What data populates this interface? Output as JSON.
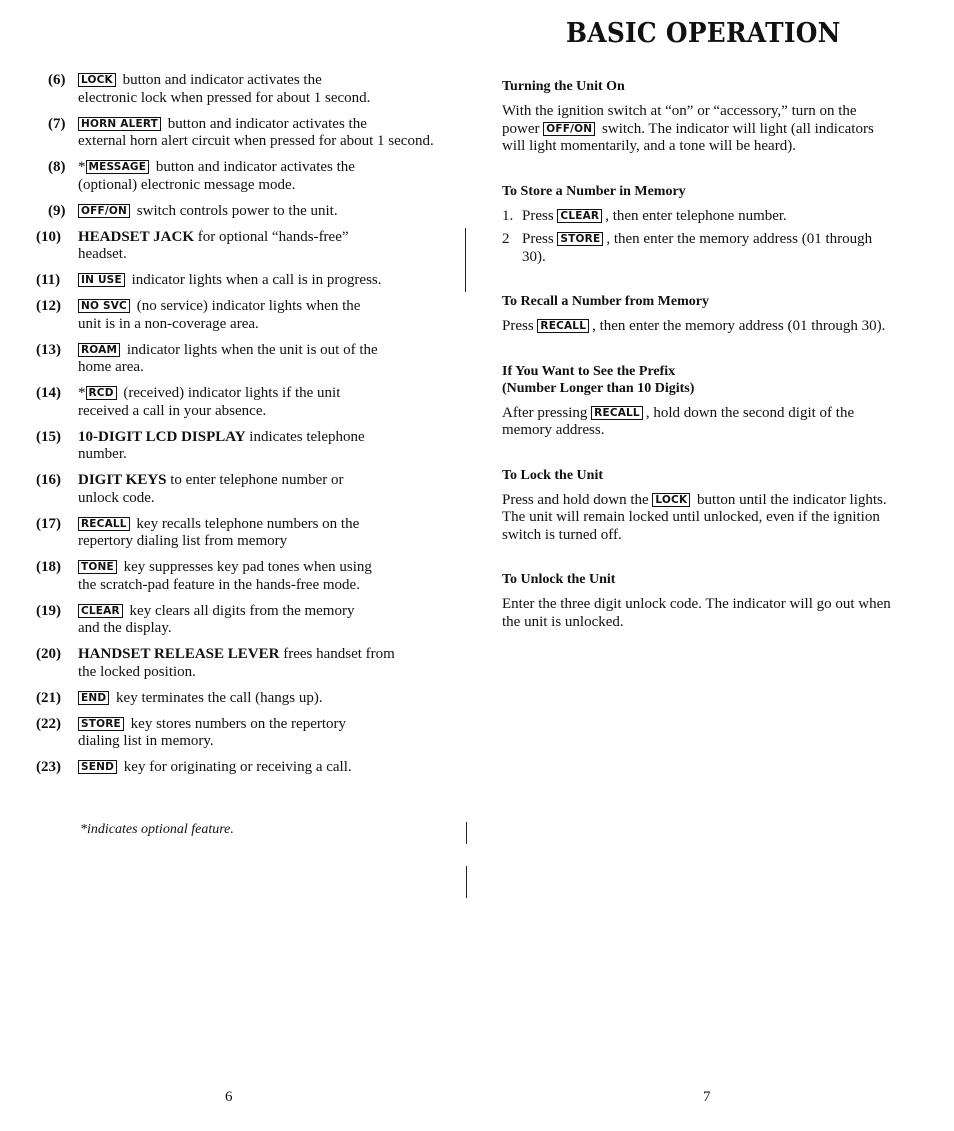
{
  "header": {
    "title": "BASIC OPERATION"
  },
  "left_column": {
    "items": [
      {
        "num": "(6)",
        "prefix": "",
        "key": "LOCK",
        "term": "",
        "text": "button and indicator activates the",
        "cont": "electronic lock when pressed for about 1 second."
      },
      {
        "num": "(7)",
        "prefix": "",
        "key": "HORN ALERT",
        "term": "",
        "text": "button and indicator activates the",
        "cont": "external horn alert circuit when pressed for about 1 second."
      },
      {
        "num": "(8)",
        "prefix": "*",
        "key": "MESSAGE",
        "term": "",
        "text": "button and indicator activates the",
        "cont": "(optional) electronic message mode."
      },
      {
        "num": "(9)",
        "prefix": "",
        "key": "OFF/ON",
        "term": "",
        "text": "switch controls power to the unit.",
        "cont": ""
      },
      {
        "num": "(10)",
        "prefix": "",
        "key": "",
        "term": "HEADSET JACK",
        "text": "for optional “hands-free”",
        "cont": "headset."
      },
      {
        "num": "(11)",
        "prefix": "",
        "key": "IN USE",
        "term": "",
        "text": "indicator lights when a call is in progress.",
        "cont": ""
      },
      {
        "num": "(12)",
        "prefix": "",
        "key": "NO SVC",
        "term": "",
        "text": "(no service) indicator lights when the",
        "cont": "unit is in a non-coverage area."
      },
      {
        "num": "(13)",
        "prefix": "",
        "key": "ROAM",
        "term": "",
        "text": "indicator lights when the unit is out of the",
        "cont": "home area."
      },
      {
        "num": "(14)",
        "prefix": "*",
        "key": "RCD",
        "term": "",
        "text": "(received) indicator lights if the unit",
        "cont": "received a call in your absence."
      },
      {
        "num": "(15)",
        "prefix": "",
        "key": "",
        "term": "10-DIGIT LCD DISPLAY",
        "text": "indicates telephone",
        "cont": "number."
      },
      {
        "num": "(16)",
        "prefix": "",
        "key": "",
        "term": "DIGIT KEYS",
        "text": "to enter telephone number or",
        "cont": "unlock code."
      },
      {
        "num": "(17)",
        "prefix": "",
        "key": "RECALL",
        "term": "",
        "text": "key recalls telephone numbers on the",
        "cont": "repertory dialing list from memory"
      },
      {
        "num": "(18)",
        "prefix": "",
        "key": "TONE",
        "term": "",
        "text": "key suppresses key pad tones when using",
        "cont": "the scratch-pad feature in the hands-free mode."
      },
      {
        "num": "(19)",
        "prefix": "",
        "key": "CLEAR",
        "term": "",
        "text": "key clears all digits from the memory",
        "cont": "and the display."
      },
      {
        "num": "(20)",
        "prefix": "",
        "key": "",
        "term": "HANDSET RELEASE LEVER",
        "text": "frees handset from",
        "cont": "the locked position."
      },
      {
        "num": "(21)",
        "prefix": "",
        "key": "END",
        "term": "",
        "text": "key terminates the call (hangs up).",
        "cont": ""
      },
      {
        "num": "(22)",
        "prefix": "",
        "key": "STORE",
        "term": "",
        "text": "key stores numbers on the repertory",
        "cont": "dialing list in memory."
      },
      {
        "num": "(23)",
        "prefix": "",
        "key": "SEND",
        "term": "",
        "text": "key for originating or receiving a call.",
        "cont": ""
      }
    ],
    "footnote": "*indicates optional feature."
  },
  "right_column": {
    "turn_on": {
      "heading": "Turning the Unit On",
      "before": "With the ignition switch at “on” or “accessory,” turn on the power",
      "key": "OFF/ON",
      "after": "switch. The indicator will light (all indicators will light momentarily, and a tone will be heard)."
    },
    "store": {
      "heading": "To Store a Number in Memory",
      "steps": [
        {
          "num": "1.",
          "before": "Press",
          "key": "CLEAR",
          "after": ", then enter telephone number."
        },
        {
          "num": "2",
          "before": "Press",
          "key": "STORE",
          "after": ", then enter the memory address (01 through 30)."
        }
      ]
    },
    "recall": {
      "heading": "To Recall a Number from Memory",
      "before": "Press",
      "key": "RECALL",
      "after": ", then enter the memory address (01 through 30)."
    },
    "prefix": {
      "heading_line1": "If You Want to See the Prefix",
      "heading_line2": "(Number Longer than 10 Digits)",
      "before": "After pressing",
      "key": "RECALL",
      "after": ", hold down the second digit of the memory address."
    },
    "lock": {
      "heading": "To Lock the Unit",
      "before": "Press and hold down the",
      "key": "LOCK",
      "after": "button until the indicator lights. The unit will remain locked until unlocked, even if the ignition switch is turned off."
    },
    "unlock": {
      "heading": "To Unlock the Unit",
      "text": "Enter the three digit unlock code. The indicator will go out  when the unit is unlocked."
    }
  },
  "footer": {
    "page_left": "6",
    "page_right": "7"
  }
}
